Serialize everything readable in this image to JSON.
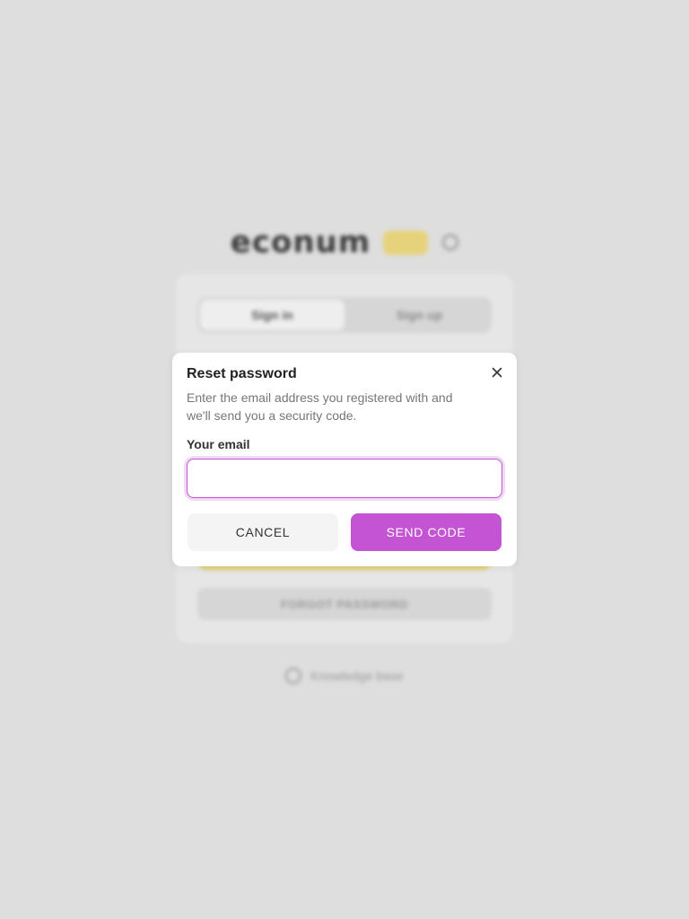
{
  "background": {
    "logo": {
      "wordmark": "econum",
      "badge": ""
    },
    "tabs": [
      {
        "label": "Sign in",
        "active": true
      },
      {
        "label": "Sign up",
        "active": false
      }
    ],
    "forgot_label": "FORGOT PASSWORD",
    "footer_text": "Knowledge base"
  },
  "modal": {
    "title": "Reset password",
    "description": "Enter the email address you registered with and we'll send you a security code.",
    "email_label": "Your email",
    "email_value": "",
    "email_placeholder": "",
    "cancel_label": "CANCEL",
    "send_label": "SEND CODE"
  },
  "colors": {
    "accent": "#c454d4",
    "background": "#dedede",
    "modal_bg": "#ffffff"
  },
  "icons": {
    "close": "close-icon",
    "language": "globe-icon"
  }
}
